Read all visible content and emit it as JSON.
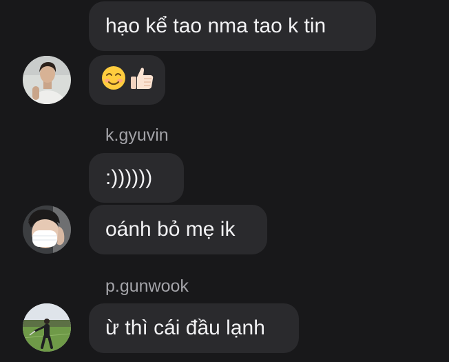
{
  "messages": [
    {
      "sender": "",
      "text": "hạo kể tao nma tao k tin"
    },
    {
      "sender": "",
      "text": ""
    },
    {
      "sender": "k.gyuvin",
      "text": ":))))))"
    },
    {
      "sender": "",
      "text": "oánh bỏ mẹ ik"
    },
    {
      "sender": "p.gunwook",
      "text": "ừ thì cái đầu lạnh"
    }
  ],
  "emoji_message": {
    "icons": [
      "smiling-face-icon",
      "thumbs-up-icon"
    ]
  },
  "colors": {
    "background": "#18181a",
    "bubble": "#2a2a2d",
    "text": "#f2f2f4",
    "sender": "#a3a3a8"
  }
}
